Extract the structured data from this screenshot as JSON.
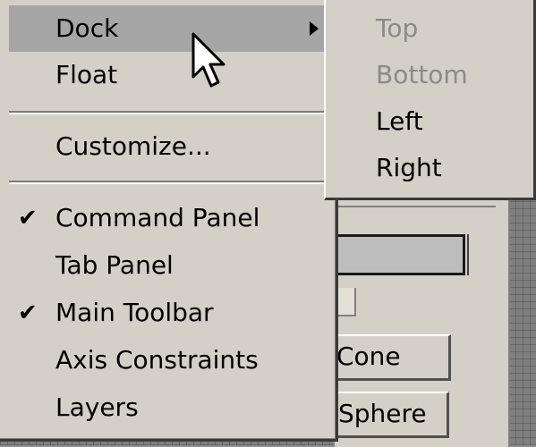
{
  "menu": {
    "items": [
      {
        "label": "Dock",
        "checked": false,
        "has_submenu": true,
        "highlighted": true
      },
      {
        "label": "Float",
        "checked": false
      },
      {
        "label": "Customize...",
        "checked": false
      },
      {
        "label": "Command Panel",
        "checked": true
      },
      {
        "label": "Tab Panel",
        "checked": false
      },
      {
        "label": "Main Toolbar",
        "checked": true
      },
      {
        "label": "Axis Constraints",
        "checked": false
      },
      {
        "label": "Layers",
        "checked": false
      }
    ],
    "check_glyph": "✔"
  },
  "submenu": {
    "items": [
      {
        "label": "Top",
        "enabled": false
      },
      {
        "label": "Bottom",
        "enabled": false
      },
      {
        "label": "Left",
        "enabled": true
      },
      {
        "label": "Right",
        "enabled": true
      }
    ]
  },
  "background": {
    "buttons": [
      {
        "label": "Cone"
      },
      {
        "label": "Sphere"
      }
    ]
  },
  "colors": {
    "menu_bg": "#d4d0c8",
    "highlight": "#a6a6a6",
    "disabled_text": "#8a8a8a"
  },
  "icons": {
    "cursor": "arrow-cursor-icon",
    "submenu_arrow": "submenu-arrow-icon",
    "check": "checkmark-icon"
  }
}
